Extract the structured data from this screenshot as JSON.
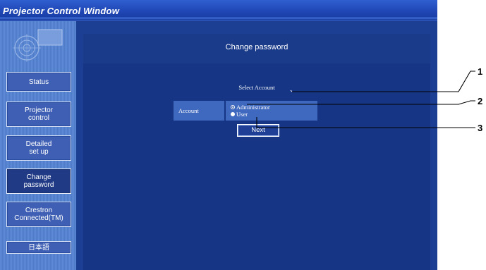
{
  "window": {
    "title": "Projector Control Window"
  },
  "sidebar": {
    "items": [
      {
        "label": "Status"
      },
      {
        "label": "Projector control"
      },
      {
        "label": "Detailed set up"
      },
      {
        "label": "Change password"
      },
      {
        "label": "Crestron Connected(TM)"
      },
      {
        "label": "日本語"
      }
    ],
    "active_index": 3
  },
  "main": {
    "title": "Change password",
    "section": "Select Account",
    "account_label": "Account",
    "options": [
      {
        "label": "Administrator",
        "selected": true
      },
      {
        "label": "User",
        "selected": false
      }
    ],
    "next_label": "Next"
  },
  "callouts": {
    "one": "1",
    "two": "2",
    "three": "3"
  },
  "colors": {
    "frame": "#0d2c78",
    "panel": "#163685",
    "cell": "#3f68bf",
    "sidebar": "#5483d0"
  }
}
